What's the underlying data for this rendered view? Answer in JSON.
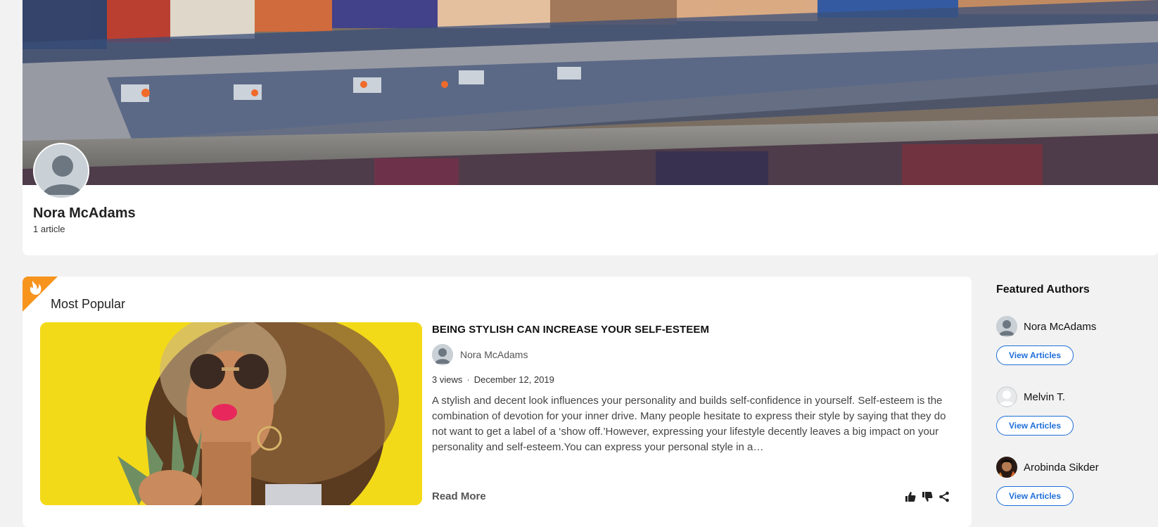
{
  "profile": {
    "name": "Nora McAdams",
    "article_count": "1 article"
  },
  "popular": {
    "section_title": "Most Popular",
    "article": {
      "title": "BEING STYLISH CAN INCREASE YOUR SELF-ESTEEM",
      "author": "Nora McAdams",
      "views": "3 views",
      "separator": "·",
      "date": "December 12, 2019",
      "excerpt": "A stylish and decent look influences your personality and builds self-confidence in yourself. Self-esteem is the combination of devotion for your inner drive. Many people hesitate to express their style by saying that they do not want to get a label of a ‘show off.’However, expressing your lifestyle decently leaves a big impact on your personality and self-esteem.You can express your personal style in a…",
      "read_more": "Read More",
      "action_icons": [
        "thumbs-up-icon",
        "thumbs-down-icon",
        "share-icon"
      ]
    }
  },
  "featured": {
    "title": "Featured Authors",
    "authors": [
      {
        "name": "Nora McAdams",
        "button": "View Articles"
      },
      {
        "name": "Melvin T.",
        "button": "View Articles"
      },
      {
        "name": "Arobinda Sikder",
        "button": "View Articles"
      }
    ]
  },
  "colors": {
    "accent_blue": "#1e6fd9",
    "fire_orange": "#f7941d",
    "page_bg": "#f2f2f2"
  }
}
